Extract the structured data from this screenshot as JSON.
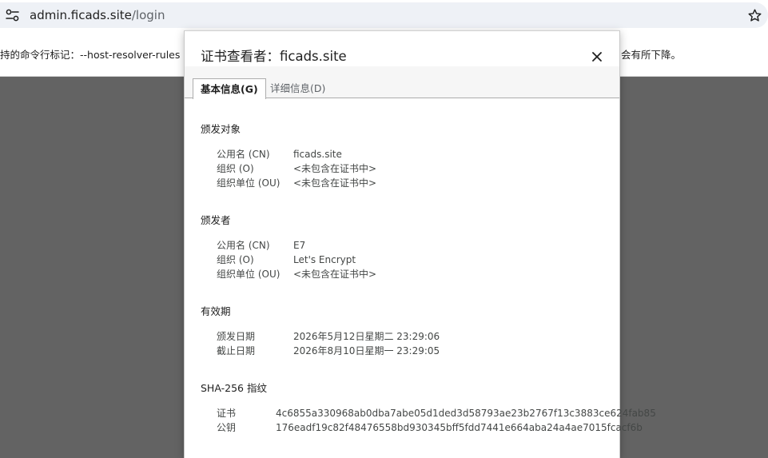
{
  "address_bar": {
    "url_host": "admin.ficads.site",
    "url_path": "/login",
    "site_info_icon": "tune-icon",
    "bookmark_icon": "star-outline-icon"
  },
  "info_bar": {
    "text_left": "持的命令行标记：--host-resolver-rules",
    "text_right": "会有所下降。"
  },
  "dialog": {
    "title": "证书查看者：ficads.site",
    "close_icon": "close-icon",
    "tabs": [
      {
        "label": "基本信息(G)",
        "selected": true
      },
      {
        "label": "详细信息(D)",
        "selected": false
      }
    ],
    "issued_to": {
      "heading": "颁发对象",
      "cn_label": "公用名 (CN)",
      "cn_value": "ficads.site",
      "o_label": "组织 (O)",
      "o_value": "<未包含在证书中>",
      "ou_label": "组织单位 (OU)",
      "ou_value": "<未包含在证书中>"
    },
    "issued_by": {
      "heading": "颁发者",
      "cn_label": "公用名 (CN)",
      "cn_value": "E7",
      "o_label": "组织 (O)",
      "o_value": "Let's Encrypt",
      "ou_label": "组织单位 (OU)",
      "ou_value": "<未包含在证书中>"
    },
    "validity": {
      "heading": "有效期",
      "issued_label": "颁发日期",
      "issued_value": "2026年5月12日星期二 23:29:06",
      "expires_label": "截止日期",
      "expires_value": "2026年8月10日星期一 23:29:05"
    },
    "fingerprints": {
      "heading": "SHA-256 指纹",
      "cert_label": "证书",
      "cert_value": "4c6855a330968ab0dba7abe05d1ded3d58793ae23b2767f13c3883ce624fab85",
      "key_label": "公钥",
      "key_value": "176eadf19c82f48476558bd930345bff5fdd7441e664aba24a4ae7015fcacf6b"
    }
  },
  "colors": {
    "page_overlay": "#636363",
    "omnibox_bg": "#eef1f6",
    "dialog_bg": "#ffffff",
    "tab_strip_bg": "#f6f6f6"
  }
}
